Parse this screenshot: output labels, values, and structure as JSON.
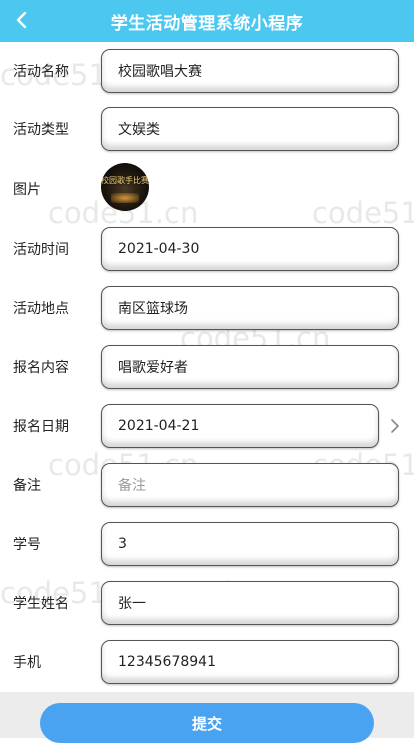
{
  "header": {
    "title": "学生活动管理系统小程序",
    "back_icon": "chevron-left-icon",
    "background": "#4cc8f0"
  },
  "form": {
    "activity_name": {
      "label": "活动名称",
      "value": "校园歌唱大赛"
    },
    "activity_type": {
      "label": "活动类型",
      "value": "文娱类"
    },
    "image": {
      "label": "图片",
      "thumb_text": "校园歌手比赛"
    },
    "activity_time": {
      "label": "活动时间",
      "value": "2021-04-30"
    },
    "location": {
      "label": "活动地点",
      "value": "南区篮球场"
    },
    "signup_content": {
      "label": "报名内容",
      "value": "唱歌爱好者"
    },
    "signup_date": {
      "label": "报名日期",
      "value": "2021-04-21",
      "chevron_icon": "chevron-right-icon"
    },
    "remark": {
      "label": "备注",
      "placeholder": "备注"
    },
    "student_id": {
      "label": "学号",
      "value": "3"
    },
    "student_name": {
      "label": "学生姓名",
      "value": "张一"
    },
    "phone": {
      "label": "手机",
      "value": "12345678941"
    }
  },
  "submit_label": "提交",
  "submit_color": "#4aa3f0",
  "watermark": "code51.cn"
}
